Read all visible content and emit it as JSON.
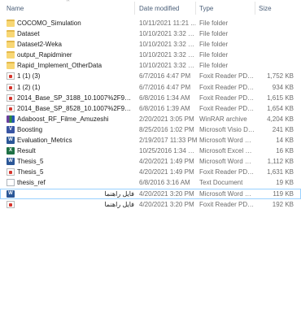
{
  "header": {
    "name": "Name",
    "date_modified": "Date modified",
    "type": "Type",
    "size": "Size",
    "sort_glyph": "^"
  },
  "files": [
    {
      "name": "COCOMO_Simulation",
      "date": "10/11/2021 11:21 ...",
      "type": "File folder",
      "size": "",
      "icon": "folder-icon"
    },
    {
      "name": "Dataset",
      "date": "10/10/2021 3:32 PM",
      "type": "File folder",
      "size": "",
      "icon": "folder-icon"
    },
    {
      "name": "Dataset2-Weka",
      "date": "10/10/2021 3:32 PM",
      "type": "File folder",
      "size": "",
      "icon": "folder-icon"
    },
    {
      "name": "output_Rapidminer",
      "date": "10/10/2021 3:32 PM",
      "type": "File folder",
      "size": "",
      "icon": "folder-icon"
    },
    {
      "name": "Rapid_Implement_OtherData",
      "date": "10/10/2021 3:32 PM",
      "type": "File folder",
      "size": "",
      "icon": "folder-icon"
    },
    {
      "name": "1 (1) (3)",
      "date": "6/7/2016 4:47 PM",
      "type": "Foxit Reader PDF ...",
      "size": "1,752 KB",
      "icon": "pdf-icon"
    },
    {
      "name": "1 (2) (1)",
      "date": "6/7/2016 4:47 PM",
      "type": "Foxit Reader PDF ...",
      "size": "934 KB",
      "icon": "pdf-icon"
    },
    {
      "name": "2014_Base_SP_3188_10.1007%2F978-3-31...",
      "date": "6/8/2016 1:34 AM",
      "type": "Foxit Reader PDF ...",
      "size": "1,615 KB",
      "icon": "pdf-icon"
    },
    {
      "name": "2014_Base_SP_8528_10.1007%2F978-3-31...",
      "date": "6/8/2016 1:39 AM",
      "type": "Foxit Reader PDF ...",
      "size": "1,654 KB",
      "icon": "pdf-icon"
    },
    {
      "name": "Adaboost_RF_Filme_Amuzeshi",
      "date": "2/20/2021 3:05 PM",
      "type": "WinRAR archive",
      "size": "4,204 KB",
      "icon": "rar-icon"
    },
    {
      "name": "Boosting",
      "date": "8/25/2016 1:02 PM",
      "type": "Microsoft Visio Do...",
      "size": "241 KB",
      "icon": "visio-icon"
    },
    {
      "name": "Evaluation_Metrics",
      "date": "2/19/2017 11:33 PM",
      "type": "Microsoft Word D...",
      "size": "14 KB",
      "icon": "word-icon"
    },
    {
      "name": "Result",
      "date": "10/25/2016 1:34 PM",
      "type": "Microsoft Excel W...",
      "size": "16 KB",
      "icon": "excel-icon"
    },
    {
      "name": "Thesis_5",
      "date": "4/20/2021 1:49 PM",
      "type": "Microsoft Word D...",
      "size": "1,112 KB",
      "icon": "word-icon"
    },
    {
      "name": "Thesis_5",
      "date": "4/20/2021 1:49 PM",
      "type": "Foxit Reader PDF ...",
      "size": "1,631 KB",
      "icon": "pdf-icon"
    },
    {
      "name": "thesis_ref",
      "date": "6/8/2016 3:16 AM",
      "type": "Text Document",
      "size": "19 KB",
      "icon": "text-file-icon"
    },
    {
      "name": "فایل راهنما",
      "date": "4/20/2021 3:20 PM",
      "type": "Microsoft Word D...",
      "size": "119 KB",
      "icon": "word-icon",
      "selected": true
    },
    {
      "name": "فایل راهنما",
      "date": "4/20/2021 3:20 PM",
      "type": "Foxit Reader PDF ...",
      "size": "192 KB",
      "icon": "pdf-icon"
    }
  ]
}
